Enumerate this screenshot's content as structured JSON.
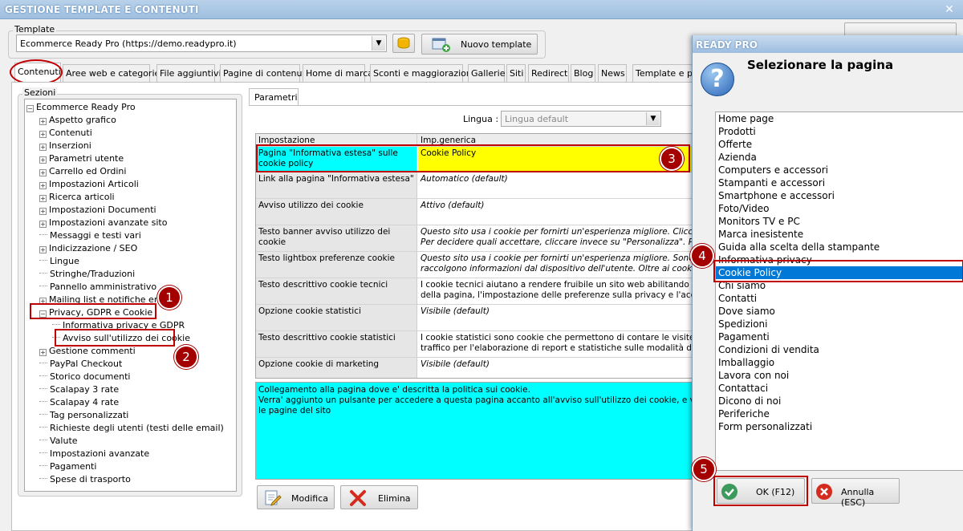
{
  "window": {
    "title": "GESTIONE TEMPLATE E CONTENUTI",
    "close_glyph": "✕"
  },
  "template": {
    "group_label": "Template",
    "selected": "Ecommerce Ready Pro (https://demo.readypro.it)",
    "new_button": "Nuovo template"
  },
  "tabs": [
    "Contenuti",
    "Aree web e categorie",
    "File aggiuntivi",
    "Pagine di contenuti",
    "Home di marca",
    "Sconti e maggiorazioni",
    "Gallerie",
    "Siti",
    "Redirect",
    "Blog",
    "News",
    "Template e plu"
  ],
  "sections": {
    "label": "Sezioni",
    "root": "Ecommerce Ready Pro",
    "items": [
      "Aspetto grafico",
      "Contenuti",
      "Inserzioni",
      "Parametri utente",
      "Carrello ed Ordini",
      "Impostazioni Articoli",
      "Ricerca articoli",
      "Impostazioni Documenti",
      "Impostazioni avanzate sito",
      "Messaggi e testi vari",
      "Indicizzazione / SEO",
      "Lingue",
      "Stringhe/Traduzioni",
      "Pannello amministrativo",
      "Mailing list e notifiche email",
      "Privacy, GDPR e Cookie",
      "Informativa privacy e GDPR",
      "Avviso sull'utilizzo dei cookie",
      "Gestione commenti",
      "PayPal Checkout",
      "Storico documenti",
      "Scalapay 3 rate",
      "Scalapay 4 rate",
      "Tag personalizzati",
      "Richieste degli utenti (testi delle email)",
      "Valute",
      "Impostazioni avanzate",
      "Pagamenti",
      "Spese di trasporto"
    ]
  },
  "params": {
    "tab": "Parametri",
    "lingua_label": "Lingua :",
    "lingua_value": "Lingua default",
    "headers": [
      "Impostazione",
      "Imp.generica"
    ],
    "rows": [
      {
        "name": "Pagina \"Informativa estesa\" sulle cookie policy",
        "value": "Cookie Policy"
      },
      {
        "name": "Link alla pagina \"Informativa estesa\"",
        "value": "Automatico (default)"
      },
      {
        "name": "Avviso utilizzo dei cookie",
        "value": "Attivo (default)"
      },
      {
        "name": "Testo banner avviso utilizzo dei cookie",
        "value": "Questo sito usa i cookie per fornirti un'esperienza migliore. Cliccando su",
        "value2": "Per decidere quali accettare, cliccare invece su \"Personalizza\". Per mag"
      },
      {
        "name": "Testo lightbox preferenze cookie",
        "value": "Questo sito usa i cookie per fornirti un'esperienza migliore. Sono utilizz",
        "value2": "raccolgono informazioni dal dispositivo dell'utente. Oltre ai cookie tecnici"
      },
      {
        "name": "Testo descrittivo cookie tecnici",
        "value": "I cookie tecnici aiutano a rendere fruibile un sito web abilitando le funzi",
        "value2": "della pagina, l'impostazione delle preferenze sulla privacy e l'accesso o"
      },
      {
        "name": "Opzione cookie statistici",
        "value": "Visibile (default)"
      },
      {
        "name": "Testo descrittivo cookie statistici",
        "value": "I cookie statistici sono cookie che permettono di contare le visite e font",
        "value2": "traffico per l'elaborazione di report e statistiche sulle modalità di naviga"
      },
      {
        "name": "Opzione cookie di marketing",
        "value": "Visibile (default)"
      }
    ],
    "description": [
      "Collegamento alla pagina dove e' descritta la politica sui cookie.",
      "Verra' aggiunto un pulsante per accedere a questa pagina accanto all'avviso sull'utilizzo dei cookie, e verra' inserit",
      "le pagine del sito"
    ],
    "modify_button": "Modifica",
    "delete_button": "Elimina"
  },
  "dialog": {
    "title": "READY PRO",
    "heading": "Selezionare la pagina",
    "question_glyph": "?",
    "pages": [
      "Home page",
      "Prodotti",
      "Offerte",
      "Azienda",
      "Computers e accessori",
      "Stampanti e accessori",
      "Smartphone e accessori",
      "Foto/Video",
      "Monitors TV e PC",
      "Marca inesistente",
      "Guida alla scelta della stampante",
      "Informativa privacy",
      "Cookie Policy",
      "Chi siamo",
      "Contatti",
      "Dove siamo",
      "Spedizioni",
      "Pagamenti",
      "Condizioni di vendita",
      "Imballaggio",
      "Lavora con noi",
      "Contattaci",
      "Dicono di noi",
      "Periferiche",
      "Form personalizzati"
    ],
    "selected_index": 12,
    "ok_button": "OK (F12)",
    "cancel_button": "Annulla (ESC)"
  },
  "callouts": [
    "1",
    "2",
    "3",
    "4",
    "5"
  ],
  "colors": {
    "highlight_yellow": "#ffff00",
    "highlight_cyan": "#00ffff",
    "selection_blue": "#0078d7",
    "callout_red": "#a40000"
  }
}
